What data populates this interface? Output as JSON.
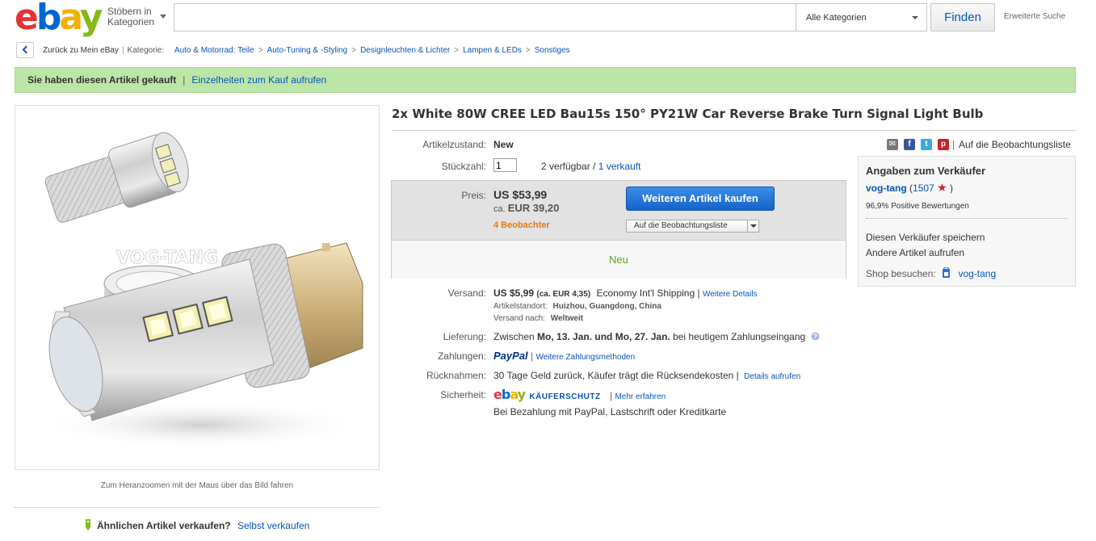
{
  "header": {
    "browse_line1": "Stöbern in",
    "browse_line2": "Kategorien",
    "search_placeholder": "",
    "category_selected": "Alle Kategorien",
    "find_button": "Finden",
    "advanced_search": "Erweiterte Suche"
  },
  "breadcrumb": {
    "back_label": "Zurück zu Mein eBay",
    "category_label": "Kategorie:",
    "items": [
      "Auto & Motorrad: Teile",
      "Auto-Tuning & -Styling",
      "Designleuchten & Lichter",
      "Lampen & LEDs",
      "Sonstiges"
    ]
  },
  "banner": {
    "text": "Sie haben diesen Artikel gekauft",
    "link": "Einzelheiten zum Kauf aufrufen"
  },
  "image": {
    "watermark": "VOG-TANG",
    "zoom_hint": "Zum Heranzoomen mit der Maus über das Bild fahren"
  },
  "sell_similar": {
    "question": "Ähnlichen Artikel verkaufen?",
    "link": "Selbst verkaufen"
  },
  "item": {
    "title": "2x White 80W CREE LED Bau15s 150° PY21W Car Reverse Brake Turn Signal Light Bulb",
    "condition_label": "Artikelzustand:",
    "condition_value": "New",
    "quantity_label": "Stückzahl:",
    "quantity_value": "1",
    "available": "2 verfügbar /",
    "sold_link": "1 verkauft",
    "price_label": "Preis:",
    "price": "US $53,99",
    "price_eur_prefix": "ca.",
    "price_eur": "EUR 39,20",
    "watchers": "4 Beobachter",
    "buy_button": "Weiteren Artikel kaufen",
    "watch_button": "Auf die Beobachtungsliste",
    "status": "Neu"
  },
  "shipping": {
    "label": "Versand:",
    "cost": "US $5,99",
    "cost_eur": "(ca. EUR 4,35)",
    "method": "Economy Int'l Shipping |",
    "details_link": "Weitere Details",
    "location_label": "Artikelstandort:",
    "location": "Huizhou, Guangdong, China",
    "ships_to_label": "Versand nach:",
    "ships_to": "Weltweit"
  },
  "delivery": {
    "label": "Lieferung:",
    "prefix": "Zwischen",
    "range": "Mo, 13. Jan. und Mo, 27. Jan.",
    "suffix": "bei heutigem Zahlungseingang"
  },
  "payments": {
    "label": "Zahlungen:",
    "paypal": "PayPal",
    "link": "Weitere Zahlungsmethoden"
  },
  "returns": {
    "label": "Rücknahmen:",
    "text": "30 Tage Geld zurück, Käufer trägt die Rücksendekosten |",
    "link": "Details aufrufen"
  },
  "security": {
    "label": "Sicherheit:",
    "badge": "KÄUFERSCHUTZ",
    "link": "Mehr erfahren",
    "note": "Bei Bezahlung mit PayPal, Lastschrift oder Kreditkarte"
  },
  "share": {
    "watchlist_link": "Auf die Beobachtungsliste"
  },
  "seller": {
    "heading": "Angaben zum Verkäufer",
    "name": "vog-tang",
    "score_open": "(",
    "score": "1507",
    "score_close": ")",
    "positive": "96,9% Positive Bewertungen",
    "save_link": "Diesen Verkäufer speichern",
    "other_items_link": "Andere Artikel aufrufen",
    "shop_label": "Shop besuchen:",
    "shop_link": "vog-tang"
  },
  "colors": {
    "link": "#0654ba",
    "banner_bg": "#bce6a8",
    "watchers": "#e47911",
    "status_green": "#5ba71b",
    "buy_button": "#1f6fd6"
  }
}
